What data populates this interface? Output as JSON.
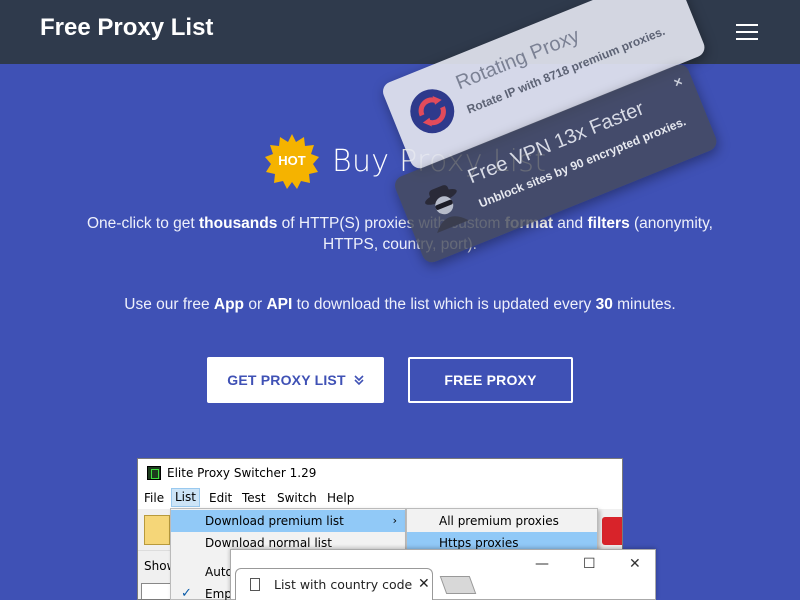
{
  "nav": {
    "brand": "Free Proxy List",
    "menu_icon": "hamburger-menu-icon"
  },
  "hero": {
    "badge": "HOT",
    "title": "Buy Proxy List",
    "desc1_a": "One-click to get ",
    "desc1_b": "thousands",
    "desc1_c": " of HTTP(S) proxies with custom ",
    "desc1_d": "format",
    "desc1_e": " and ",
    "desc1_f": "filters",
    "desc1_g": " (anonymity, HTTPS, country, port).",
    "desc2_a": "Use our free ",
    "desc2_b": "App",
    "desc2_c": " or ",
    "desc2_d": "API",
    "desc2_e": " to download the list which is updated every ",
    "desc2_f": "30",
    "desc2_g": " minutes.",
    "btn_primary": "GET PROXY LIST",
    "btn_outline": "FREE PROXY"
  },
  "promos": {
    "rotating_title": "Rotating Proxy",
    "rotating_sub": "Rotate IP with 8718 premium proxies.",
    "vpn_title": "Free VPN 13x Faster",
    "vpn_sub": "Unblock sites by 90 encrypted proxies.",
    "close": "×"
  },
  "app": {
    "title": "Elite Proxy Switcher 1.29",
    "menu": [
      "File",
      "List",
      "Edit",
      "Test",
      "Switch",
      "Help"
    ],
    "show": "Show",
    "dropdown": [
      "Download premium list",
      "Download normal list",
      "Auto",
      "Empt"
    ],
    "submenu": [
      "All premium proxies",
      "Https proxies"
    ]
  },
  "browser": {
    "tab_title": "List with country code",
    "tab_close": "✕",
    "min": "—",
    "max": "☐",
    "close": "✕"
  },
  "colors": {
    "hero_bg": "#3f51b5",
    "navbar_bg": "#2f3a4c",
    "hot_badge": "#f5b300"
  }
}
